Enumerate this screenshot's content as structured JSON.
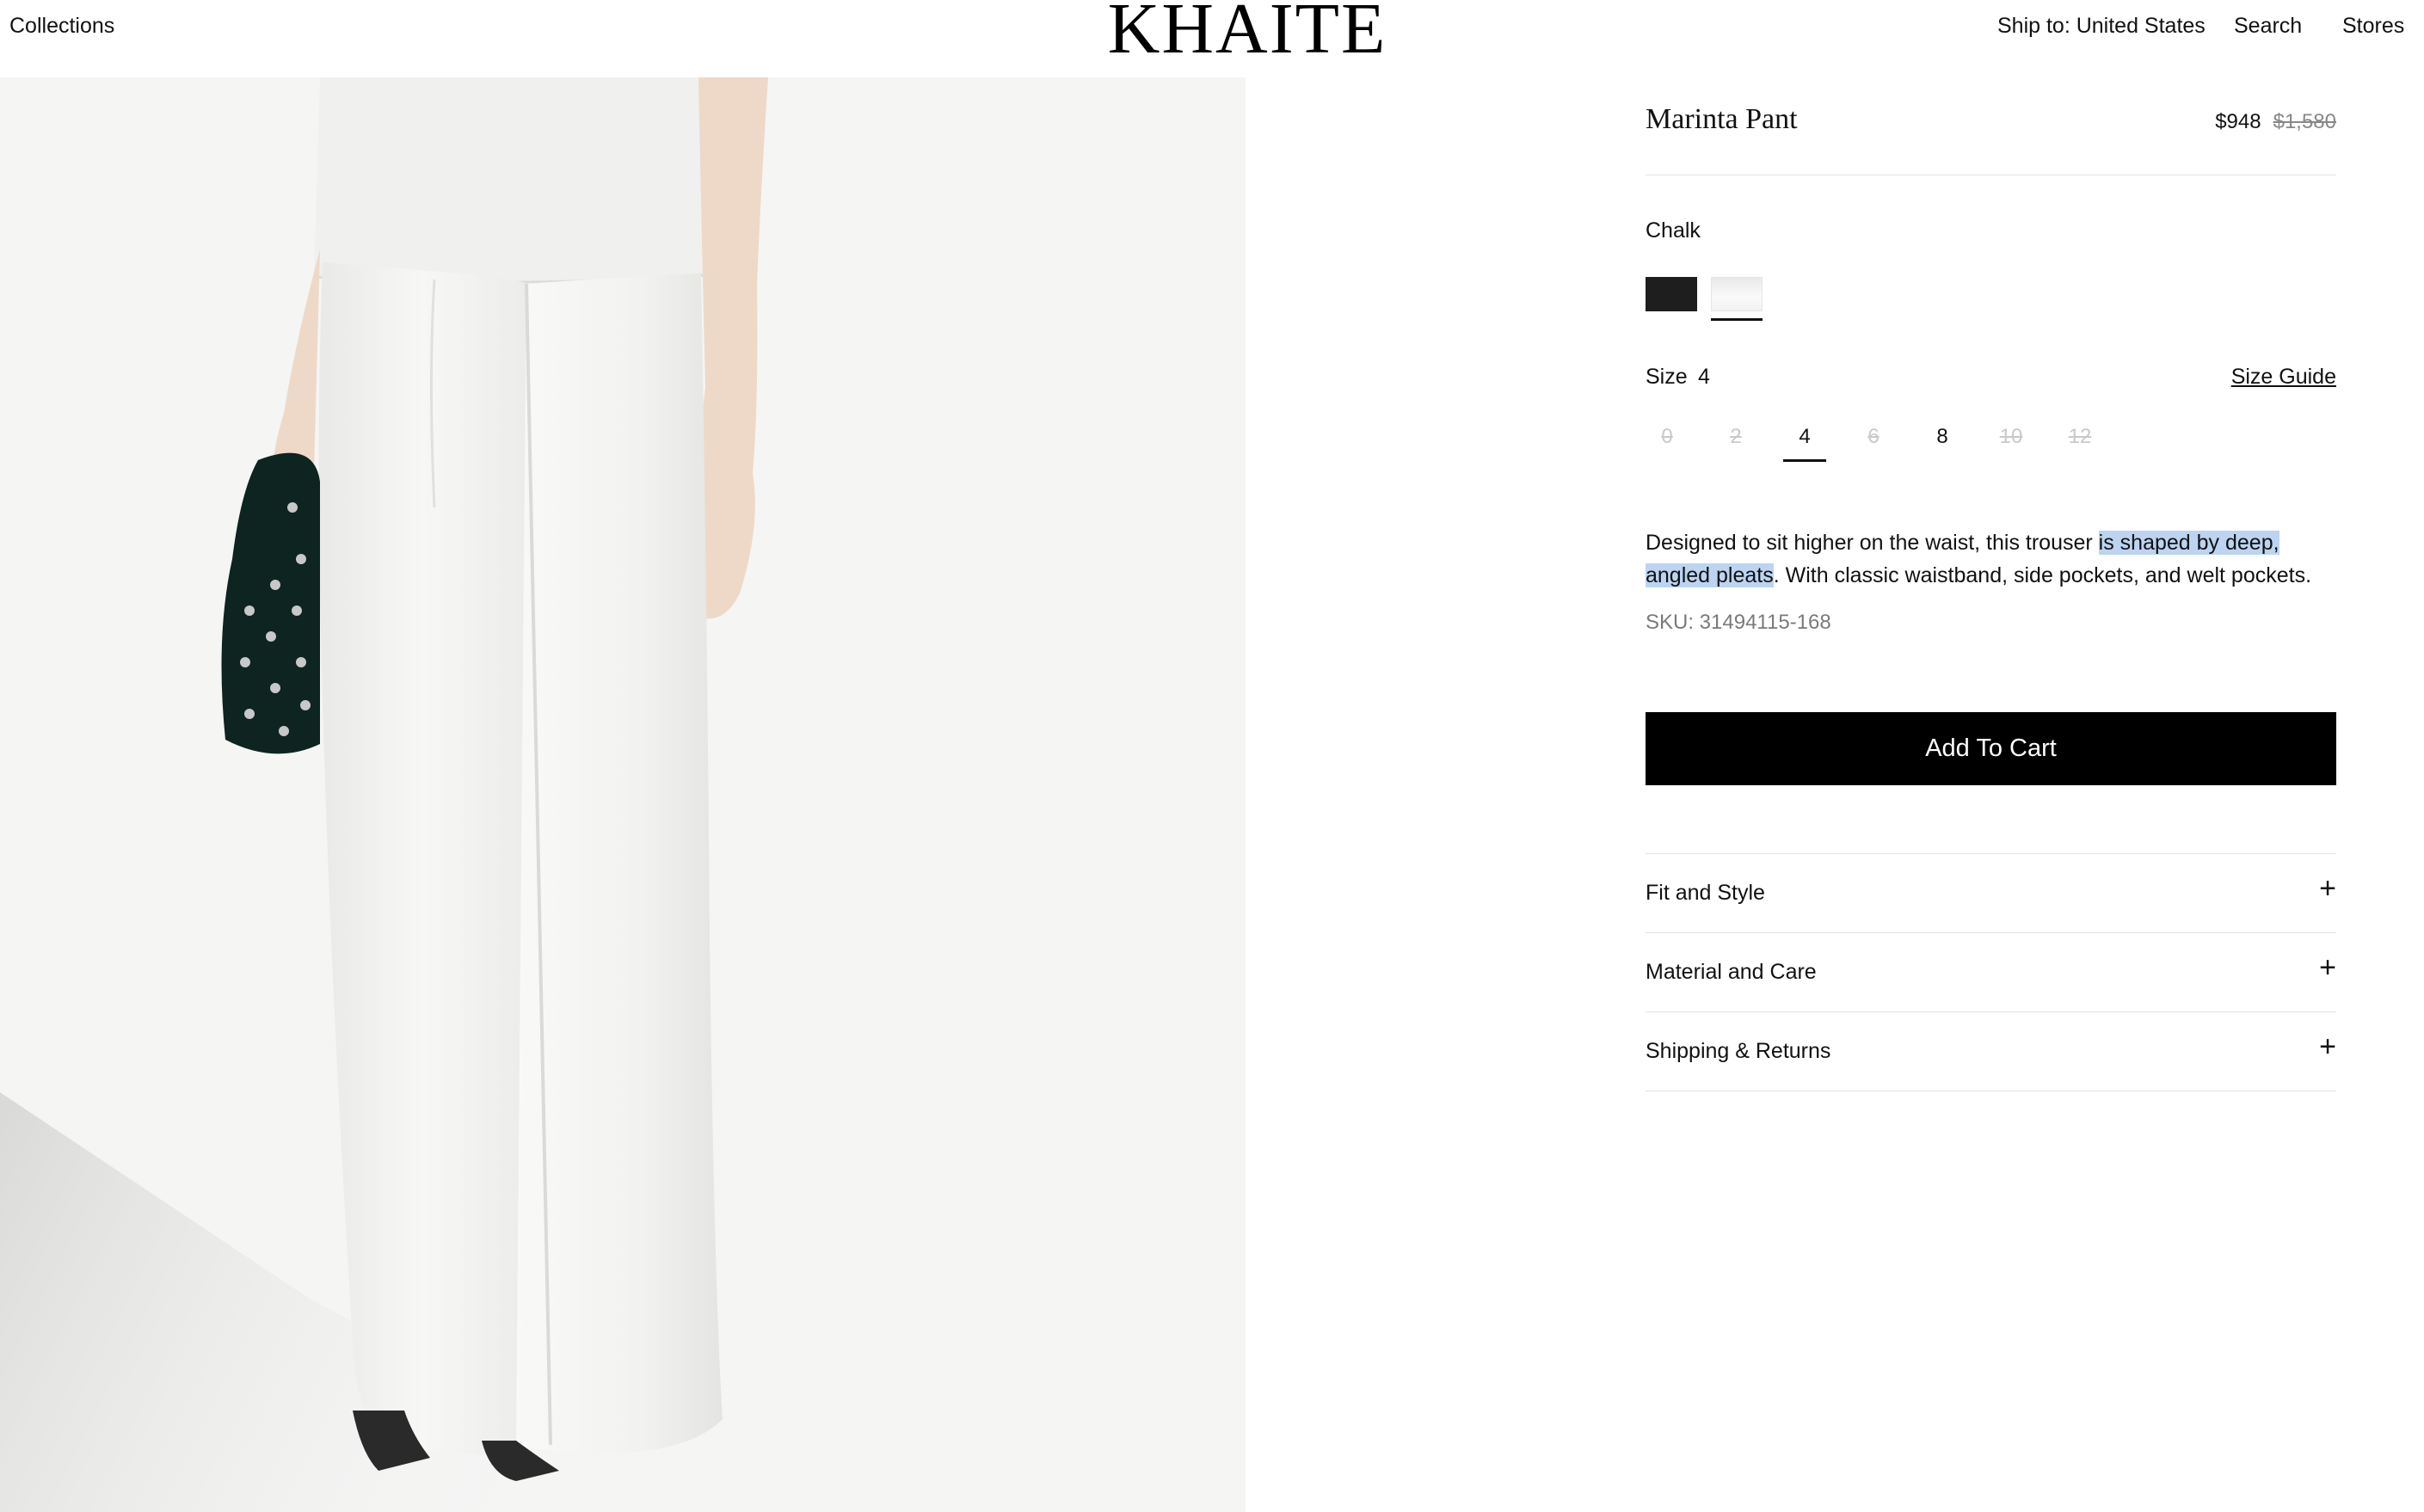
{
  "header": {
    "collections": "Collections",
    "logo": "KHAITE",
    "ship_to": "Ship to: United States",
    "search": "Search",
    "stores": "Stores"
  },
  "product": {
    "title": "Marinta Pant",
    "price_sale": "$948",
    "price_original": "$1,580",
    "color_name": "Chalk",
    "swatches": [
      {
        "name": "black",
        "color": "#1e1e1e",
        "selected": false
      },
      {
        "name": "chalk",
        "color": "#f3f3f3",
        "selected": true
      }
    ],
    "size_label": "Size",
    "size_selected": "4",
    "size_guide": "Size Guide",
    "sizes": [
      {
        "label": "0",
        "available": false
      },
      {
        "label": "2",
        "available": false
      },
      {
        "label": "4",
        "available": true,
        "selected": true
      },
      {
        "label": "6",
        "available": false
      },
      {
        "label": "8",
        "available": true
      },
      {
        "label": "10",
        "available": false
      },
      {
        "label": "12",
        "available": false
      }
    ],
    "description_part1": "Designed to sit higher on the waist, this trouser ",
    "description_highlight": "is shaped by deep, angled pleats",
    "description_part2": ". With classic waistband, side pockets, and welt pockets.",
    "sku": "SKU: 31494115-168",
    "add_to_cart": "Add To Cart",
    "accordions": [
      {
        "label": "Fit and Style",
        "icon": "plus-icon"
      },
      {
        "label": "Material and Care",
        "icon": "plus-icon"
      },
      {
        "label": "Shipping & Returns",
        "icon": "plus-icon"
      }
    ],
    "highlight_color": "#bcd4f1"
  }
}
